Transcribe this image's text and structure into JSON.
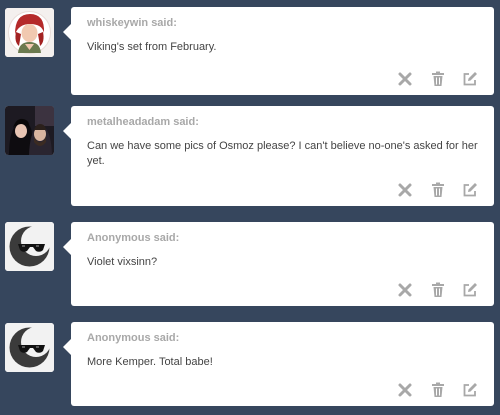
{
  "messages": [
    {
      "asker": "whiskeywin said:",
      "question": "Viking's set from February.",
      "avatar": "redhead-woman-avatar"
    },
    {
      "asker": "metalheadadam said:",
      "question": "Can we have some pics of Osmoz please? I can't believe no-one's asked for her yet.",
      "avatar": "couple-photo-avatar"
    },
    {
      "asker": "Anonymous said:",
      "question": "Violet vixsinn?",
      "avatar": "anonymous-sunglasses-avatar"
    },
    {
      "asker": "Anonymous said:",
      "question": "More Kemper. Total babe!",
      "avatar": "anonymous-sunglasses-avatar"
    }
  ],
  "icons": {
    "delete": "x-icon",
    "trash": "trash-icon",
    "edit": "edit-icon"
  },
  "colors": {
    "background": "#36465d",
    "card": "#ffffff",
    "asker": "#a8a8a8",
    "text": "#444444",
    "control": "#a8a8a8"
  }
}
